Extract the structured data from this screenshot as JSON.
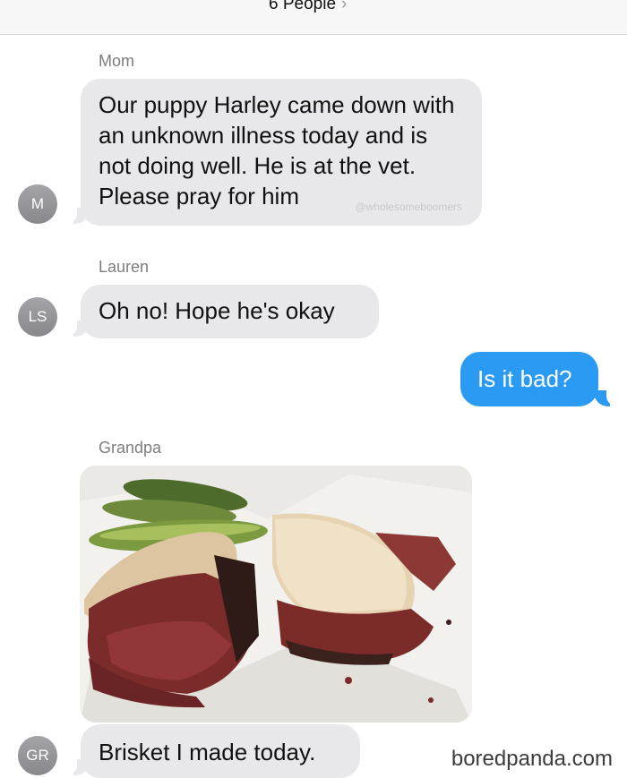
{
  "header": {
    "title": "6 People",
    "chevron_icon": "chevron-right-icon"
  },
  "messages": [
    {
      "sender": "Mom",
      "avatar": "M",
      "text": "Our puppy Harley came down with an unknown illness today and is not doing well. He is at the vet. Please pray for him",
      "watermark": "@wholesomeboomers"
    },
    {
      "sender": "Lauren",
      "avatar": "LS",
      "text": "Oh no! Hope he's okay"
    },
    {
      "outgoing": true,
      "text": "Is it bad?"
    },
    {
      "sender": "Grandpa",
      "avatar": "GR",
      "image": "brisket-sandwich-photo",
      "text": "Brisket I made today."
    }
  ],
  "site_watermark": "boredpanda.com",
  "colors": {
    "incoming_bubble": "#e8e8ea",
    "outgoing_bubble": "#2a9af2",
    "avatar": "#98989c"
  }
}
